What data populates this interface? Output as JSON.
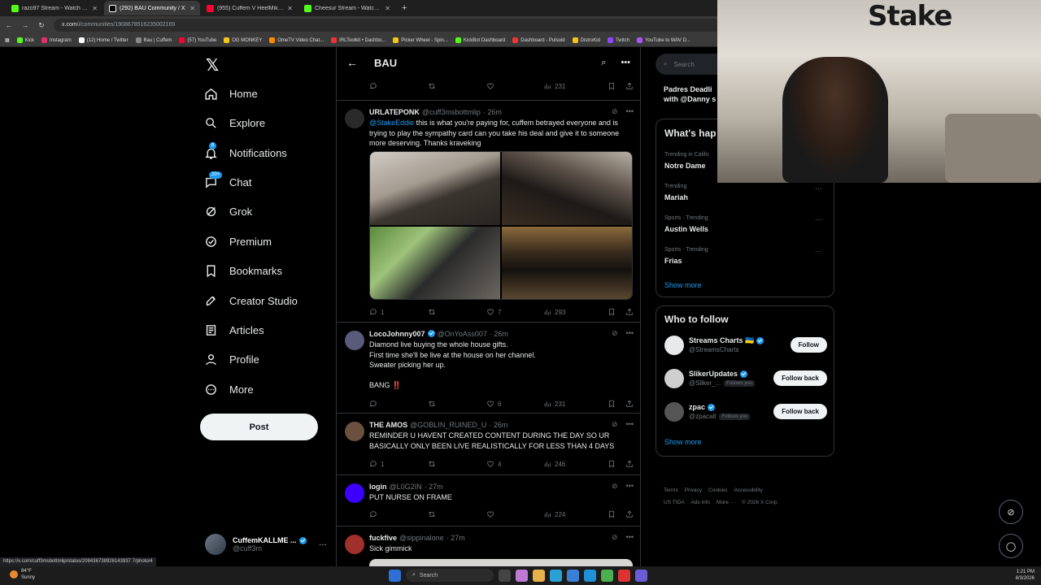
{
  "browser": {
    "tabs": [
      {
        "title": "razo97 Stream - Watch Live on",
        "active": false,
        "color": "#53fc18"
      },
      {
        "title": "(292) BAU Community / X",
        "active": true,
        "color": "#ffffff"
      },
      {
        "title": "(955) Cuffem V HeelMike Swea",
        "active": false,
        "color": "#ff0033"
      },
      {
        "title": "Cheesur Stream - Watch Live o",
        "active": false,
        "color": "#53fc18"
      }
    ],
    "new_tab": "+",
    "url_host": "x.com",
    "url_path": "/i/communities/1908678516235002169",
    "bookmarks": [
      {
        "label": "Kick",
        "color": "#53fc18"
      },
      {
        "label": "Instagram",
        "color": "#e1306c"
      },
      {
        "label": "(12) Home / Twitter",
        "color": "#ffffff"
      },
      {
        "label": "Bau | Cuffem",
        "color": "#888888"
      },
      {
        "label": "(57) YouTube",
        "color": "#ff0033"
      },
      {
        "label": "OG MONKEY",
        "color": "#f5c518"
      },
      {
        "label": "OmeTV Video Chat...",
        "color": "#ff8a00"
      },
      {
        "label": "IRLToolkit • Dashbo...",
        "color": "#e33"
      },
      {
        "label": "Picker Wheel - Spin...",
        "color": "#f5c518"
      },
      {
        "label": "KickBot Dashboard",
        "color": "#53fc18"
      },
      {
        "label": "Dashboard - Pulsoid",
        "color": "#e33"
      },
      {
        "label": "DistroKid",
        "color": "#f5c518"
      },
      {
        "label": "Twitch",
        "color": "#9146ff"
      },
      {
        "label": "YouTube to WAV D...",
        "color": "#a855f7"
      }
    ],
    "status_url": "https://x.com/cuff3msbottmlip/status/208436738926143937 7/photo/4"
  },
  "leftnav": {
    "items": [
      {
        "label": "Home",
        "icon": "home-icon"
      },
      {
        "label": "Explore",
        "icon": "search-icon"
      },
      {
        "label": "Notifications",
        "icon": "bell-icon",
        "badge": "8"
      },
      {
        "label": "Chat",
        "icon": "chat-icon",
        "badge": "20+"
      },
      {
        "label": "Grok",
        "icon": "grok-icon"
      },
      {
        "label": "Premium",
        "icon": "premium-icon"
      },
      {
        "label": "Bookmarks",
        "icon": "bookmark-icon"
      },
      {
        "label": "Creator Studio",
        "icon": "rocket-icon"
      },
      {
        "label": "Articles",
        "icon": "articles-icon"
      },
      {
        "label": "Profile",
        "icon": "profile-icon"
      },
      {
        "label": "More",
        "icon": "more-icon"
      }
    ],
    "post_label": "Post",
    "account": {
      "name": "CuffemKALLME ...",
      "handle": "@cuff3m",
      "more": "···"
    }
  },
  "feed": {
    "title": "BAU",
    "top_views": "231",
    "posts": [
      {
        "name": "URLATEPONK",
        "handle": "@cuff3msbottmlip",
        "time": "· 26m",
        "mention": "@StakeEddie",
        "text": " this is what you're paying for, cuffem betrayed everyone and is trying to play the sympathy card can you take his deal and give it to someone more deserving. Thanks kraveking",
        "replies": "1",
        "reposts": "",
        "likes": "7",
        "views": "293",
        "avatar_color": "#2a2a2a"
      },
      {
        "name": "LocoJohnny007",
        "handle": "@OnYoAss007",
        "time": "· 26m",
        "text": "Diamond live buying the whole house gifts.\nFirst time she'll be live at the house on her channel.\nSweater picking her up.\n\nBANG ‼️",
        "replies": "",
        "reposts": "",
        "likes": "6",
        "views": "231",
        "avatar_color": "#5a5a7a"
      },
      {
        "name": "THE AMOS",
        "handle": "@GOBLIN_RUINED_U",
        "time": "· 26m",
        "text": "REMINDER U HAVENT CREATED CONTENT DURING THE DAY SO UR BASICALLY ONLY BEEN LIVE REALISTICALLY FOR LESS THAN 4 DAYS",
        "replies": "1",
        "reposts": "",
        "likes": "4",
        "views": "246",
        "avatar_color": "#6b5040"
      },
      {
        "name": "login",
        "handle": "@L0G2IN",
        "time": "· 27m",
        "text": "PUT NURSE ON FRAME",
        "replies": "",
        "reposts": "",
        "likes": "",
        "views": "224",
        "avatar_color": "#3b00ff"
      },
      {
        "name": "fuckfive",
        "handle": "@sippinalone",
        "time": "· 27m",
        "text": "Sick gimmick",
        "avatar_color": "#a0302a"
      }
    ]
  },
  "right": {
    "search_placeholder": "Search",
    "partial_title": "Padres Deadli\nwith @Danny s",
    "happening_title": "What's hap",
    "trends": [
      {
        "meta": "Trending in Califo",
        "name": "Notre Dame"
      },
      {
        "meta": "Trending",
        "name": "Mariah"
      },
      {
        "meta": "Sports · Trending",
        "name": "Austin Wells"
      },
      {
        "meta": "Sports · Trending",
        "name": "Frias"
      }
    ],
    "show_more": "Show more",
    "wtf_title": "Who to follow",
    "follow": [
      {
        "name": "Streams Charts 🇺🇦",
        "handle": "@StreamsCharts",
        "button": "Follow",
        "follows_you": "",
        "avatar_color": "#e7e9ea"
      },
      {
        "name": "SlikerUpdates",
        "handle": "@Sliker_...",
        "button": "Follow back",
        "follows_you": "Follows you",
        "avatar_color": "#cfcfcf"
      },
      {
        "name": "zpac",
        "handle": "@zpacalt",
        "button": "Follow back",
        "follows_you": "Follows you",
        "avatar_color": "#555555"
      }
    ],
    "show_more_2": "Show more",
    "footer": [
      "Terms",
      "Privacy",
      "Cookies",
      "Accessibility",
      "US TIDA",
      "Ads info",
      "More ···",
      "© 2026 X Corp."
    ]
  },
  "webcam": {
    "brand": "Stake"
  },
  "taskbar": {
    "temp": "84°F",
    "weather": "Sunny",
    "search": "Search",
    "time": "1:21 PM",
    "date": "8/3/2026"
  }
}
